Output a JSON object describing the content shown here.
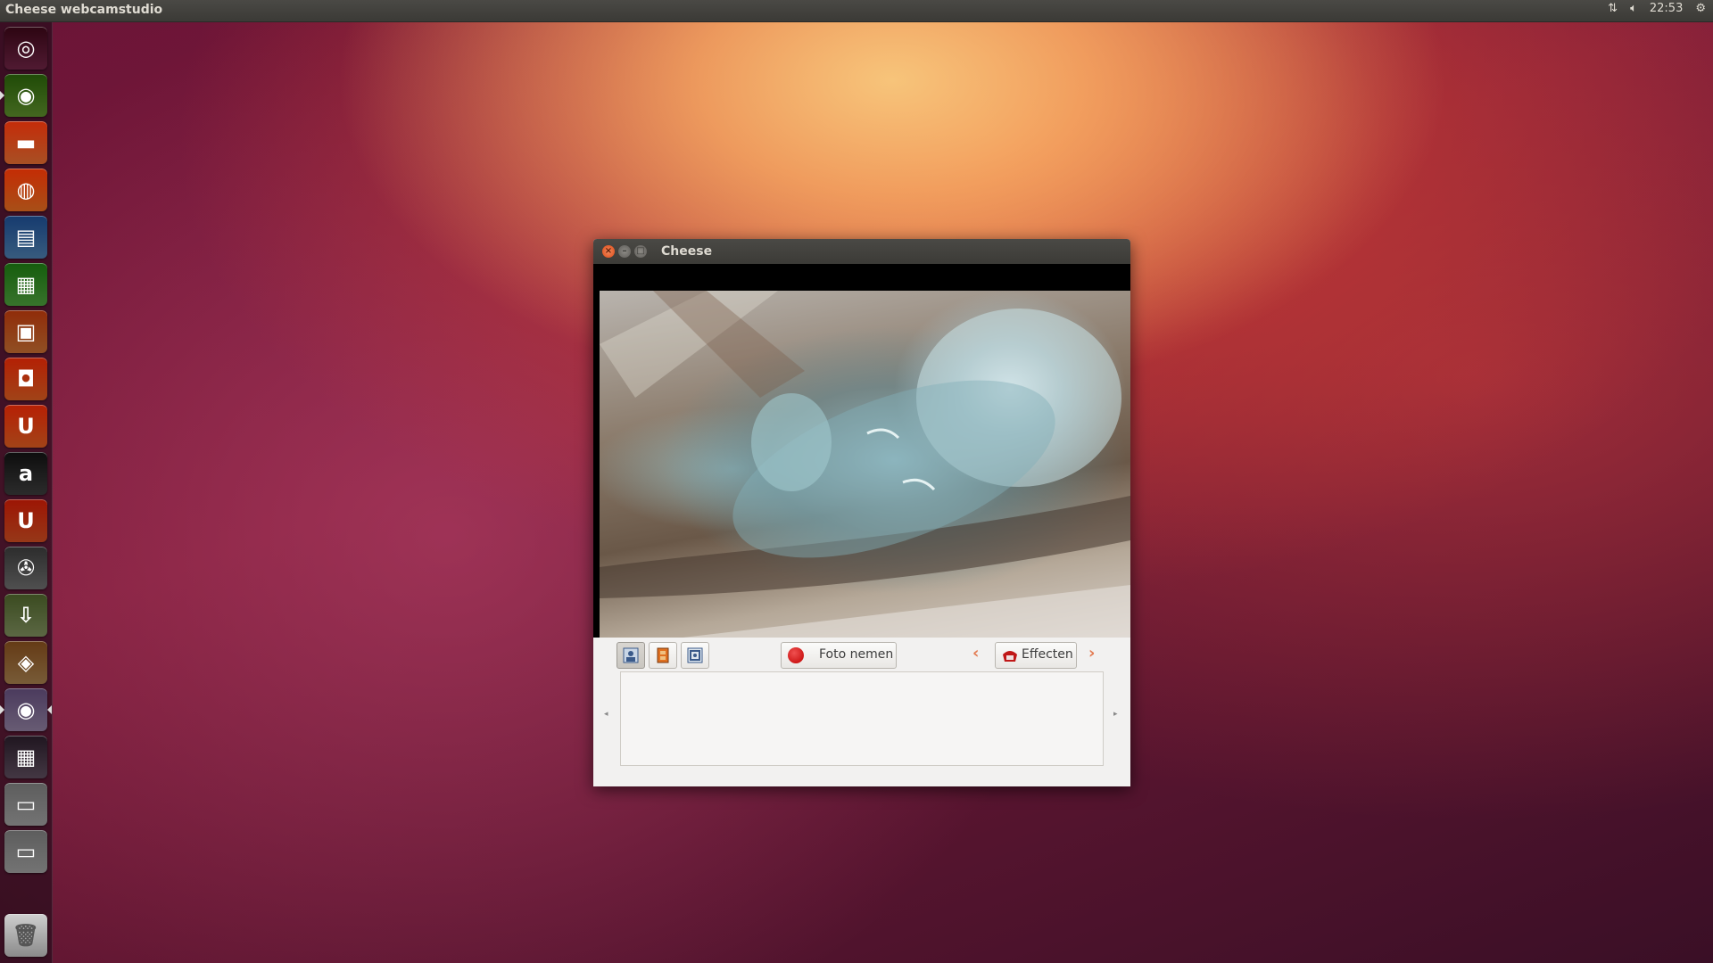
{
  "top_panel": {
    "app_title": "Cheese webcamstudio",
    "clock": "22:53",
    "network_icon": "network-updown-icon",
    "volume_icon": "volume-icon",
    "settings_icon": "gear-icon"
  },
  "launcher": {
    "items": [
      {
        "name": "dash-home",
        "glyph": "◎",
        "color": "#6b2343"
      },
      {
        "name": "chrome",
        "glyph": "◉",
        "color": "#5a8a2a"
      },
      {
        "name": "files",
        "glyph": "▬",
        "color": "#e06a30"
      },
      {
        "name": "firefox",
        "glyph": "◍",
        "color": "#e06a20"
      },
      {
        "name": "libreoffice-writer",
        "glyph": "▤",
        "color": "#4a7aa8"
      },
      {
        "name": "libreoffice-calc",
        "glyph": "▦",
        "color": "#4a9a3a"
      },
      {
        "name": "libreoffice-impress",
        "glyph": "▣",
        "color": "#c06a30"
      },
      {
        "name": "software-center",
        "glyph": "◘",
        "color": "#d65a20"
      },
      {
        "name": "ubuntu-one",
        "glyph": "U",
        "color": "#d85a20"
      },
      {
        "name": "amazon",
        "glyph": "a",
        "color": "#3a3a3a"
      },
      {
        "name": "ubuntu-one-music",
        "glyph": "U",
        "color": "#c84a20"
      },
      {
        "name": "system-settings",
        "glyph": "✇",
        "color": "#6a6a6a"
      },
      {
        "name": "news-downloader",
        "glyph": "⇩",
        "color": "#7a8a5a"
      },
      {
        "name": "world-map",
        "glyph": "◈",
        "color": "#a07a4a"
      },
      {
        "name": "cheese",
        "glyph": "◉",
        "color": "#8a7a9a"
      },
      {
        "name": "workspace-switcher",
        "glyph": "▦",
        "color": "#5a4a5a"
      },
      {
        "name": "drive-1",
        "glyph": "▭",
        "color": "#9a9a9a"
      },
      {
        "name": "drive-2",
        "glyph": "▭",
        "color": "#9a9a9a"
      }
    ],
    "trash_icon": "trash-icon"
  },
  "window": {
    "title": "Cheese",
    "close_icon": "close-icon",
    "minimize_icon": "minimize-icon",
    "maximize_icon": "maximize-icon",
    "toolbar": {
      "mode_photo_icon": "photo-mode-icon",
      "mode_video_icon": "video-mode-icon",
      "mode_burst_icon": "burst-mode-icon",
      "take_photo_label": "Foto nemen",
      "prev_icon": "chevron-left-icon",
      "effects_label": "Effecten",
      "next_icon": "chevron-right-icon"
    }
  },
  "colors": {
    "accent": "#dd4814",
    "panel": "#3c3b37"
  }
}
